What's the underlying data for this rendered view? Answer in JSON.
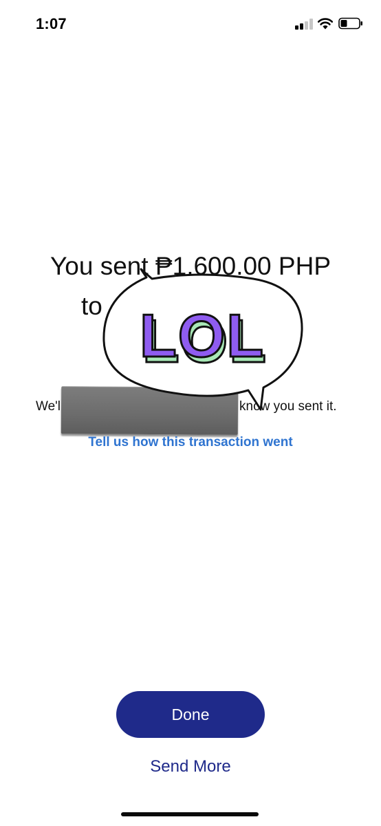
{
  "status_bar": {
    "time": "1:07",
    "icons": [
      "cellular-signal-icon",
      "wifi-icon",
      "battery-icon"
    ]
  },
  "confirmation": {
    "headline_line1": "You sent ₱1,600.00 PHP",
    "headline_line2_visible": "to",
    "info_left_visible": "We'l",
    "info_right_visible": "know you sent it.",
    "feedback_link": "Tell us how this transaction went"
  },
  "sticker": {
    "text": "LOL",
    "fill_color": "#8f5cf0",
    "shadow_color": "#a8e8b6"
  },
  "actions": {
    "done_label": "Done",
    "send_more_label": "Send More"
  },
  "colors": {
    "primary_button": "#1f2a8a",
    "link": "#2f74d0",
    "text": "#111111",
    "redaction": "#6c6c6c"
  }
}
